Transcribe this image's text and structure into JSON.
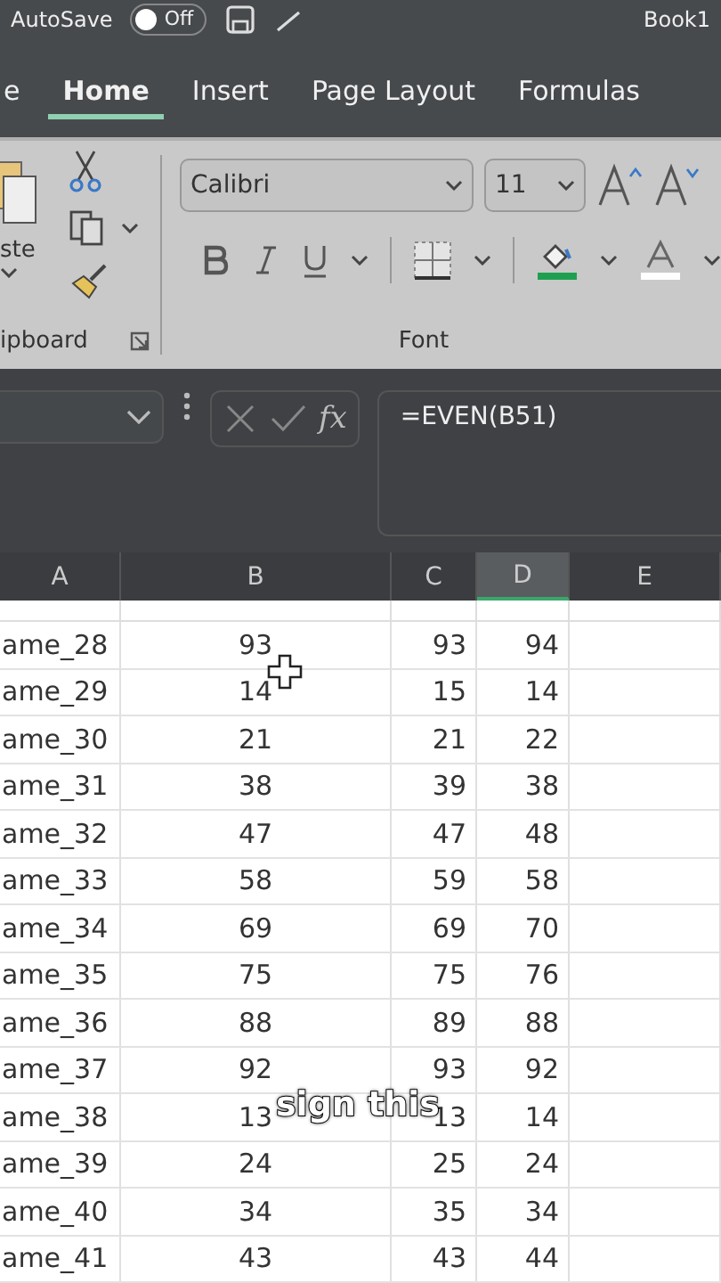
{
  "title_bar": {
    "autosave_label": "AutoSave",
    "autosave_toggle": {
      "label": "Off",
      "on": false
    },
    "document_title": "Book1"
  },
  "tabs": [
    {
      "label": "e",
      "selected": false
    },
    {
      "label": "Home",
      "selected": true
    },
    {
      "label": "Insert",
      "selected": false
    },
    {
      "label": "Page Layout",
      "selected": false
    },
    {
      "label": "Formulas",
      "selected": false
    }
  ],
  "clipboard": {
    "paste_label": "ste",
    "group_label": "ipboard"
  },
  "font": {
    "font_name": "Calibri",
    "font_size": "11",
    "group_label": "Font"
  },
  "formula_bar": {
    "fx_label": "fx",
    "formula": "=EVEN(B51)"
  },
  "columns": [
    {
      "label": "A",
      "selected": false
    },
    {
      "label": "B",
      "selected": false
    },
    {
      "label": "C",
      "selected": false
    },
    {
      "label": "D",
      "selected": true
    },
    {
      "label": "E",
      "selected": false
    }
  ],
  "rows": [
    {
      "cells": [
        "ame_28",
        "93",
        "93",
        "94"
      ]
    },
    {
      "cells": [
        "ame_29",
        "14",
        "15",
        "14"
      ]
    },
    {
      "cells": [
        "ame_30",
        "21",
        "21",
        "22"
      ]
    },
    {
      "cells": [
        "ame_31",
        "38",
        "39",
        "38"
      ]
    },
    {
      "cells": [
        "ame_32",
        "47",
        "47",
        "48"
      ]
    },
    {
      "cells": [
        "ame_33",
        "58",
        "59",
        "58"
      ]
    },
    {
      "cells": [
        "ame_34",
        "69",
        "69",
        "70"
      ]
    },
    {
      "cells": [
        "ame_35",
        "75",
        "75",
        "76"
      ]
    },
    {
      "cells": [
        "ame_36",
        "88",
        "89",
        "88"
      ]
    },
    {
      "cells": [
        "ame_37",
        "92",
        "93",
        "92"
      ]
    },
    {
      "cells": [
        "ame_38",
        "13",
        "13",
        "14"
      ]
    },
    {
      "cells": [
        "ame_39",
        "24",
        "25",
        "24"
      ]
    },
    {
      "cells": [
        "ame_40",
        "34",
        "35",
        "34"
      ]
    },
    {
      "cells": [
        "ame_41",
        "43",
        "43",
        "44"
      ]
    }
  ],
  "caption": "sign this"
}
